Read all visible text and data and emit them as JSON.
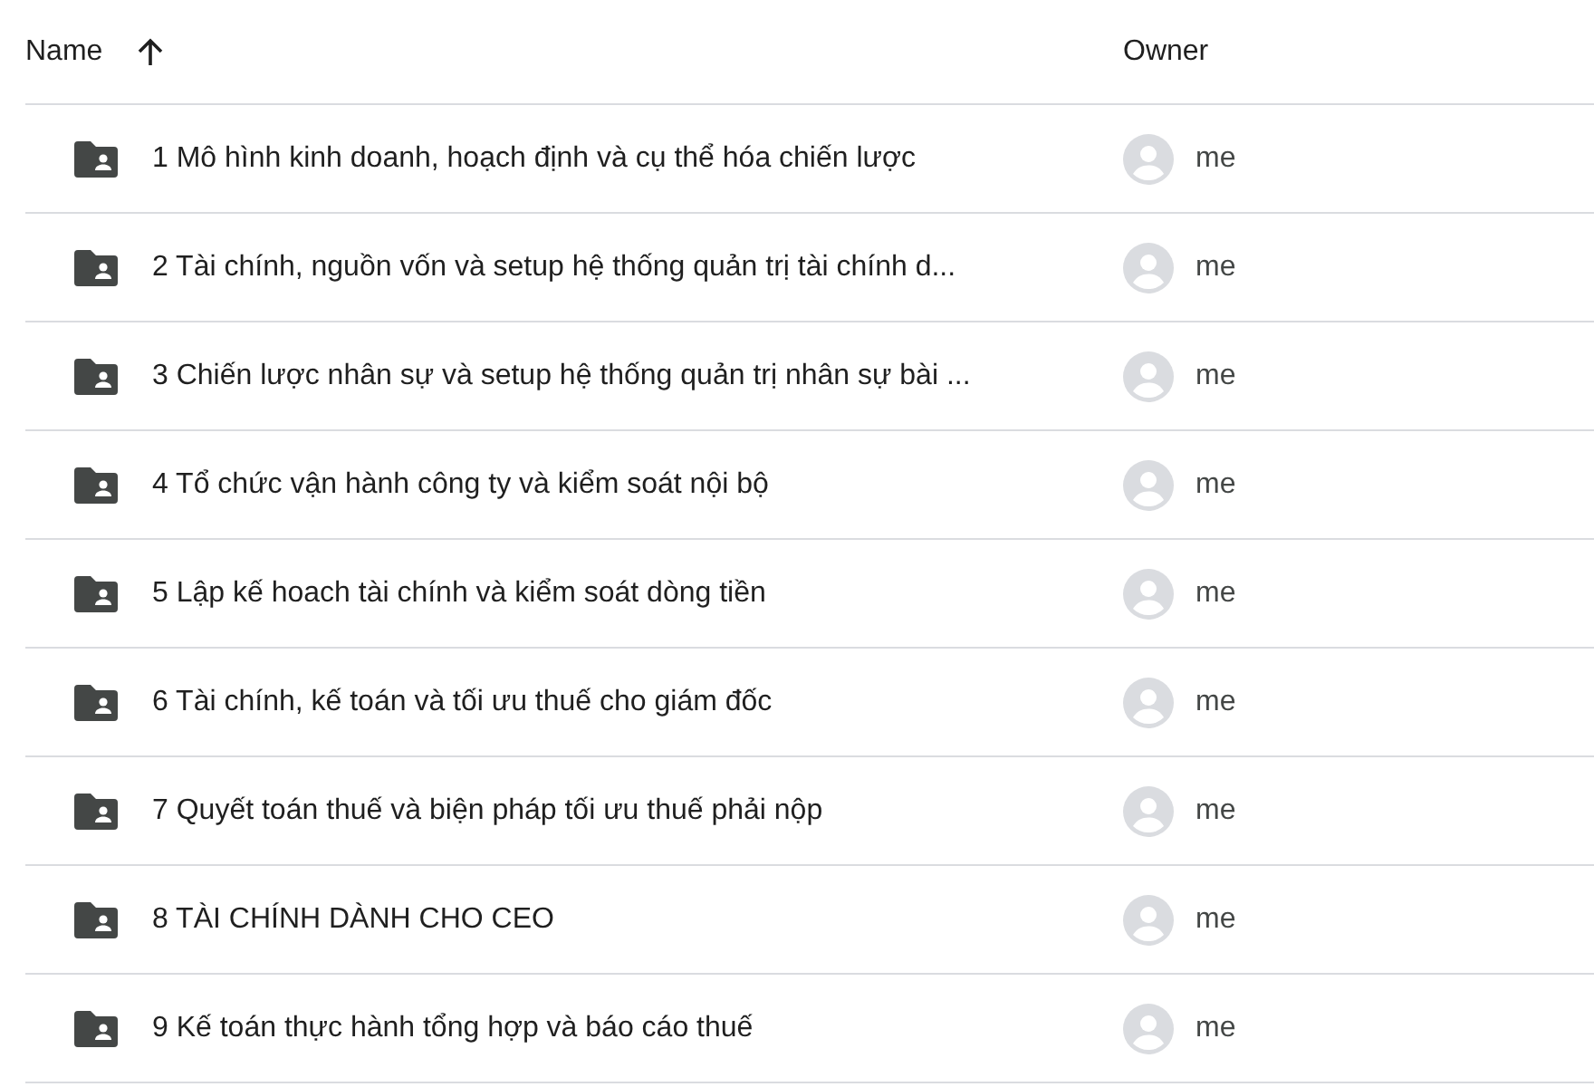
{
  "columns": [
    {
      "label": "Name",
      "sorted": true
    },
    {
      "label": "Owner",
      "sorted": false
    }
  ],
  "rows": [
    {
      "name": "1 Mô hình kinh doanh, hoạch định và cụ thể hóa chiến lược",
      "owner": "me"
    },
    {
      "name": "2 Tài chính, nguồn vốn và setup hệ thống quản trị tài chính d...",
      "owner": "me"
    },
    {
      "name": "3 Chiến lược nhân sự và setup hệ thống quản trị nhân sự bài ...",
      "owner": "me"
    },
    {
      "name": "4 Tổ chức vận hành công ty và kiểm soát nội bộ",
      "owner": "me"
    },
    {
      "name": "5 Lập kế hoach tài chính và kiểm soát dòng tiền",
      "owner": "me"
    },
    {
      "name": "6 Tài chính, kế toán và tối ưu thuế cho giám đốc",
      "owner": "me"
    },
    {
      "name": "7 Quyết toán thuế và biện pháp tối ưu thuế phải nộp",
      "owner": "me"
    },
    {
      "name": "8 TÀI CHÍNH DÀNH CHO CEO",
      "owner": "me"
    },
    {
      "name": "9 Kế toán thực hành tổng hợp và báo cáo thuế",
      "owner": "me"
    }
  ]
}
